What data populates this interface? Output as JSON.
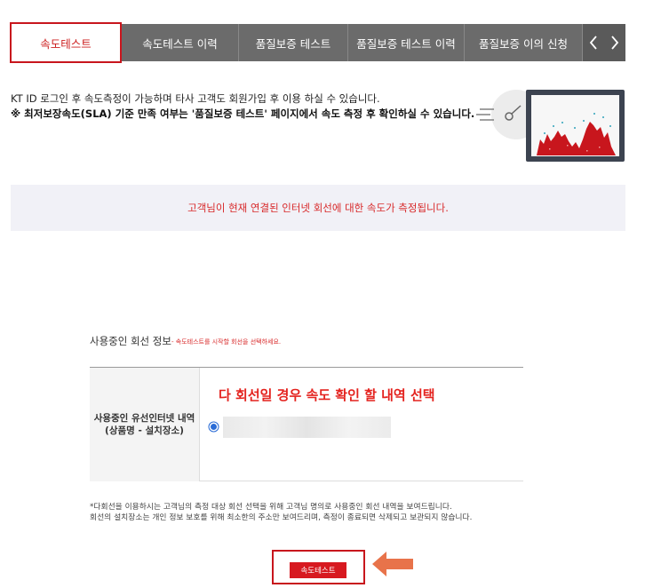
{
  "tabs": [
    {
      "label": "속도테스트",
      "active": true
    },
    {
      "label": "속도테스트 이력",
      "active": false
    },
    {
      "label": "품질보증 테스트",
      "active": false
    },
    {
      "label": "품질보증 테스트 이력",
      "active": false
    },
    {
      "label": "품질보증 이의 신청",
      "active": false
    }
  ],
  "tab_nav": {
    "prev_icon": "chevron-left-icon",
    "next_icon": "chevron-right-icon"
  },
  "notice": {
    "line1": "KT ID 로그인 후 속도측정이 가능하며 타사 고객도 회원가입 후 이용 하실 수 있습니다.",
    "line2": "※ 최저보장속도(SLA) 기준 만족 여부는 '품질보증 테스트' 페이지에서 속도 측정 후 확인하실 수 있습니다."
  },
  "banner_text": "고객님이 현재 연결된 인터넷 회선에 대한 속도가 측정됩니다.",
  "line_info": {
    "title": "사용중인 회선 정보",
    "hint": "- 속도테스트를 시작할 회선을 선택하세요.",
    "row_label_line1": "사용중인 유선인터넷 내역",
    "row_label_line2": "(상품명 - 설치장소)",
    "selected_line_redacted": true
  },
  "annotation": "다 회선일 경우 속도 확인 할 내역 선택",
  "footnote": {
    "line1": "*다회선을 이용하시는 고객님의 측정 대상 회선 선택을 위해 고객님 명의로 사용중인 회선 내역을 보여드립니다.",
    "line2": " 회선의 설치장소는 개인 정보 보호를 위해 최소한의 주소만 보여드리며, 측정이 종료되면 삭제되고 보관되지 않습니다."
  },
  "cta_label": "속도테스트",
  "colors": {
    "accent": "#d71920",
    "tab_bg": "#6b6b6b",
    "banner_bg": "#f1f1f7",
    "annotation": "#e4231f",
    "arrow": "#e8734a"
  }
}
